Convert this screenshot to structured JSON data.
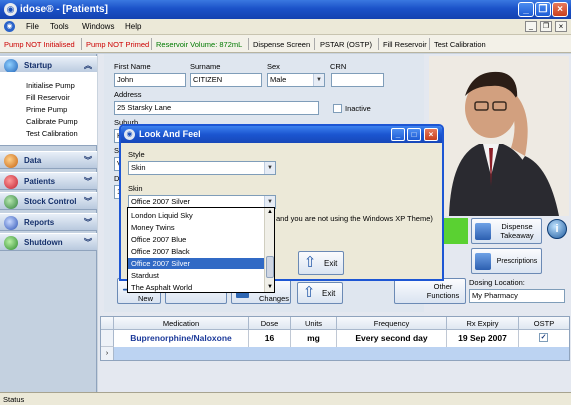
{
  "window": {
    "title": "idose® - [Patients]",
    "app_icon": "idose-app-icon",
    "controls": [
      "minimize",
      "restore",
      "close"
    ]
  },
  "menubar": [
    "File",
    "Tools",
    "Windows",
    "Help"
  ],
  "statusbar": {
    "pump_status": "Pump NOT Initialised",
    "prime_status": "Pump NOT Primed",
    "reservoir": "Reservoir Volume: 872mL",
    "dispense_screen": "Dispense Screen",
    "pstar": "PSTAR (OSTP)",
    "fill_reservoir": "Fill Reservoir",
    "test_calibration": "Test Calibration",
    "colors": {
      "alert": "#cc0000",
      "ok": "#007a00"
    }
  },
  "sidebar": {
    "sections": [
      {
        "label": "Startup",
        "icon": "startup-icon",
        "expanded": true,
        "items": [
          "Initialise Pump",
          "Fill Reservoir",
          "Prime Pump",
          "Calibrate Pump",
          "Test Calibration"
        ]
      },
      {
        "label": "Data",
        "icon": "data-icon"
      },
      {
        "label": "Patients",
        "icon": "patients-icon"
      },
      {
        "label": "Stock Control",
        "icon": "stock-control-icon"
      },
      {
        "label": "Reports",
        "icon": "reports-icon"
      },
      {
        "label": "Shutdown",
        "icon": "shutdown-icon"
      }
    ]
  },
  "form": {
    "first_name_label": "First Name",
    "first_name": "John",
    "surname_label": "Surname",
    "surname": "CITIZEN",
    "sex_label": "Sex",
    "sex": "Male",
    "crn_label": "CRN",
    "crn": "",
    "address_label": "Address",
    "address": "25 Starsky Lane",
    "inactive_label": "Inactive",
    "suburb_label": "Suburb",
    "suburb_partial": "H",
    "state_partial_label": "St",
    "state_partial": "V",
    "dob_partial_label": "D",
    "dob_partial": "1!"
  },
  "actions": {
    "dispense_takeaway": "Dispense Takeaway",
    "prescriptions": "Prescriptions",
    "exit_top": "Exit",
    "new_label": "New",
    "changes_label": "Changes",
    "exit_bottom": "Exit",
    "other_functions": "Other Functions",
    "dosing_location_label": "Dosing Location:",
    "dosing_location": "My Pharmacy"
  },
  "dialog": {
    "title": "Look And Feel",
    "style_label": "Style",
    "style_value": "Skin",
    "skin_label": "Skin",
    "skin_value": "Office 2007 Silver",
    "hint_text": "and you are not using the Windows XP Theme)",
    "exit_label": "Exit",
    "options": [
      "London Liquid Sky",
      "Money Twins",
      "Office 2007 Blue",
      "Office 2007 Black",
      "Office 2007 Silver",
      "Stardust",
      "The Asphalt World"
    ],
    "selected_index": 4
  },
  "grid": {
    "headers": [
      "Medication",
      "Dose",
      "Units",
      "Frequency",
      "Rx Expiry",
      "OSTP"
    ],
    "rows": [
      {
        "medication": "Buprenorphine/Naloxone",
        "dose": "16",
        "units": "mg",
        "frequency": "Every second day",
        "rx_expiry": "19 Sep 2007",
        "ostp": true
      }
    ]
  },
  "footer": {
    "status": "Status"
  }
}
